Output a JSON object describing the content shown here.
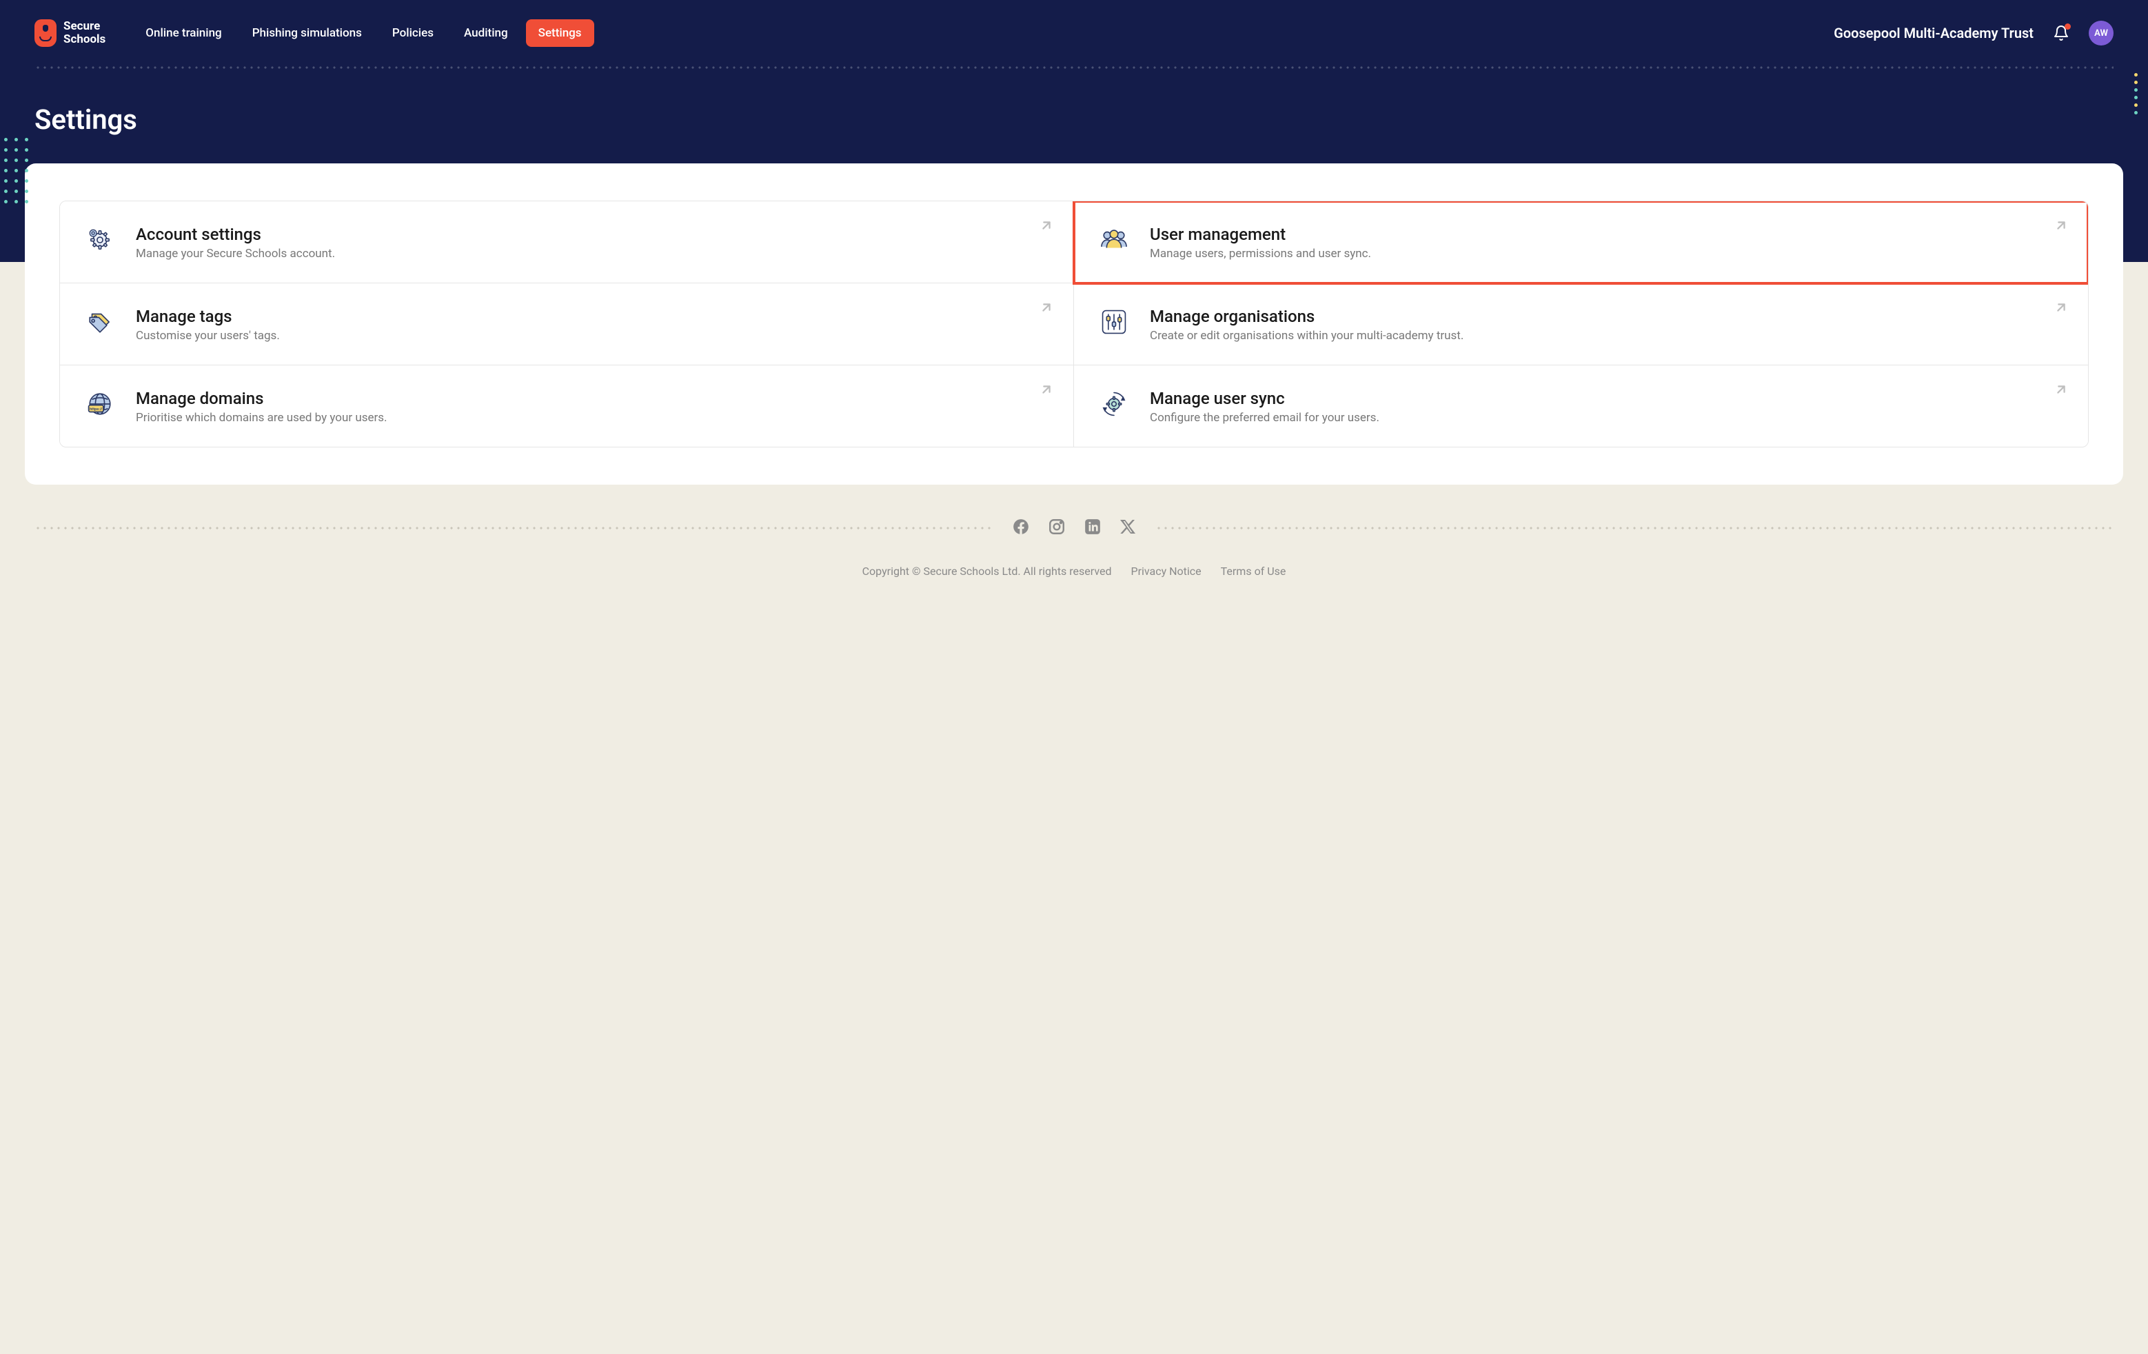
{
  "brand": {
    "line1": "Secure",
    "line2": "Schools"
  },
  "nav": {
    "items": [
      {
        "label": "Online training",
        "active": false
      },
      {
        "label": "Phishing simulations",
        "active": false
      },
      {
        "label": "Policies",
        "active": false
      },
      {
        "label": "Auditing",
        "active": false
      },
      {
        "label": "Settings",
        "active": true
      }
    ]
  },
  "org_name": "Goosepool Multi-Academy Trust",
  "avatar_initials": "AW",
  "page_title": "Settings",
  "tiles": [
    {
      "title": "Account settings",
      "desc": "Manage your Secure Schools account.",
      "icon": "gear",
      "highlighted": false
    },
    {
      "title": "User management",
      "desc": "Manage users, permissions and user sync.",
      "icon": "users",
      "highlighted": true
    },
    {
      "title": "Manage tags",
      "desc": "Customise your users' tags.",
      "icon": "tags",
      "highlighted": false
    },
    {
      "title": "Manage organisations",
      "desc": "Create or edit organisations within your multi-academy trust.",
      "icon": "sliders",
      "highlighted": false
    },
    {
      "title": "Manage domains",
      "desc": "Prioritise which domains are used by your users.",
      "icon": "globe",
      "highlighted": false
    },
    {
      "title": "Manage user sync",
      "desc": "Configure the preferred email for your users.",
      "icon": "sync-gear",
      "highlighted": false
    }
  ],
  "footer": {
    "copyright": "Copyright © Secure Schools Ltd. All rights reserved",
    "privacy": "Privacy Notice",
    "terms": "Terms of Use"
  }
}
